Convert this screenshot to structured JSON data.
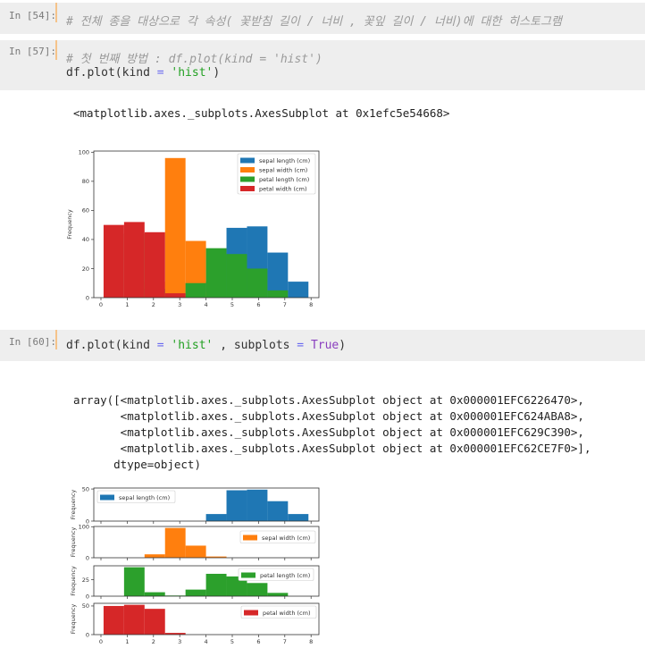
{
  "cells": [
    {
      "prompt": "In [54]:",
      "comment": "# 전체 종을 대상으로 각 속성( 꽃받침 길이 / 너비 , 꽃잎 길이 / 너비)에 대한 히스토그램"
    },
    {
      "prompt": "In [57]:",
      "comment": "# 첫 번째 방법 : df.plot(kind = 'hist')",
      "code": {
        "a": "df.plot(kind ",
        "op": "=",
        "b": " ",
        "str": "'hist'",
        "c": ")"
      },
      "output": "<matplotlib.axes._subplots.AxesSubplot at 0x1efc5e54668>"
    },
    {
      "prompt": "In [60]:",
      "code": {
        "a": "df.plot(kind ",
        "op1": "=",
        "b": " ",
        "str": "'hist'",
        "c": " , subplots ",
        "op2": "=",
        "d": " ",
        "kw": "True",
        "e": ")"
      },
      "output": [
        "array([<matplotlib.axes._subplots.AxesSubplot object at 0x000001EFC6226470>,",
        "       <matplotlib.axes._subplots.AxesSubplot object at 0x000001EFC624ABA8>,",
        "       <matplotlib.axes._subplots.AxesSubplot object at 0x000001EFC629C390>,",
        "       <matplotlib.axes._subplots.AxesSubplot object at 0x000001EFC62CE7F0>],",
        "      dtype=object)"
      ]
    }
  ],
  "chart_data": [
    {
      "type": "bar",
      "title": "",
      "ylabel": "Frequency",
      "xlabel": "",
      "xlim": [
        -0.3,
        8.3
      ],
      "ylim": [
        0,
        100.8
      ],
      "xticks": [
        "0",
        "1",
        "2",
        "3",
        "4",
        "5",
        "6",
        "7",
        "8"
      ],
      "yticks": [
        "0",
        "20",
        "40",
        "60",
        "80",
        "100"
      ],
      "legend_position": "top-right",
      "bin_edges": [
        0.1,
        0.88,
        1.66,
        2.44,
        3.22,
        4.0,
        4.78,
        5.56,
        6.34,
        7.12,
        7.9
      ],
      "series": [
        {
          "name": "sepal length (cm)",
          "color": "#1f77b4",
          "values": [
            0,
            0,
            0,
            0,
            0,
            11,
            48,
            49,
            31,
            11
          ]
        },
        {
          "name": "sepal width (cm)",
          "color": "#ff7f0e",
          "values": [
            0,
            0,
            11,
            96,
            39,
            4,
            0,
            0,
            0,
            0
          ]
        },
        {
          "name": "petal length (cm)",
          "color": "#2ca02c",
          "values": [
            0,
            44,
            6,
            1,
            10,
            34,
            30,
            20,
            5,
            0
          ]
        },
        {
          "name": "petal width (cm)",
          "color": "#d62728",
          "values": [
            50,
            52,
            45,
            3,
            0,
            0,
            0,
            0,
            0,
            0
          ]
        }
      ]
    },
    {
      "type": "bar",
      "subplots": true,
      "ylabel": "Frequency",
      "xticks": [
        "0",
        "1",
        "2",
        "3",
        "4",
        "5",
        "6",
        "7",
        "8"
      ],
      "bin_edges": [
        0.1,
        0.88,
        1.66,
        2.44,
        3.22,
        4.0,
        4.78,
        5.56,
        6.34,
        7.12,
        7.9
      ],
      "panels": [
        {
          "name": "sepal length (cm)",
          "color": "#1f77b4",
          "ylim": [
            0,
            51.5
          ],
          "yticks": [
            "0",
            "50"
          ],
          "legend_position": "top-left",
          "values": [
            0,
            0,
            0,
            0,
            0,
            11,
            48,
            49,
            31,
            11
          ]
        },
        {
          "name": "sepal width (cm)",
          "color": "#ff7f0e",
          "ylim": [
            0,
            100.8
          ],
          "yticks": [
            "0",
            "100"
          ],
          "legend_position": "top-right",
          "values": [
            0,
            0,
            11,
            96,
            39,
            4,
            0,
            0,
            0,
            0
          ]
        },
        {
          "name": "petal length (cm)",
          "color": "#2ca02c",
          "ylim": [
            0,
            46.2
          ],
          "yticks": [
            "0",
            "25"
          ],
          "legend_position": "top-right",
          "values": [
            0,
            44,
            6,
            1,
            10,
            34,
            30,
            20,
            5,
            0
          ]
        },
        {
          "name": "petal width (cm)",
          "color": "#d62728",
          "ylim": [
            0,
            54.6
          ],
          "yticks": [
            "0",
            "50"
          ],
          "legend_position": "top-right",
          "values": [
            50,
            52,
            45,
            3,
            0,
            0,
            0,
            0,
            0,
            0
          ]
        }
      ]
    }
  ]
}
